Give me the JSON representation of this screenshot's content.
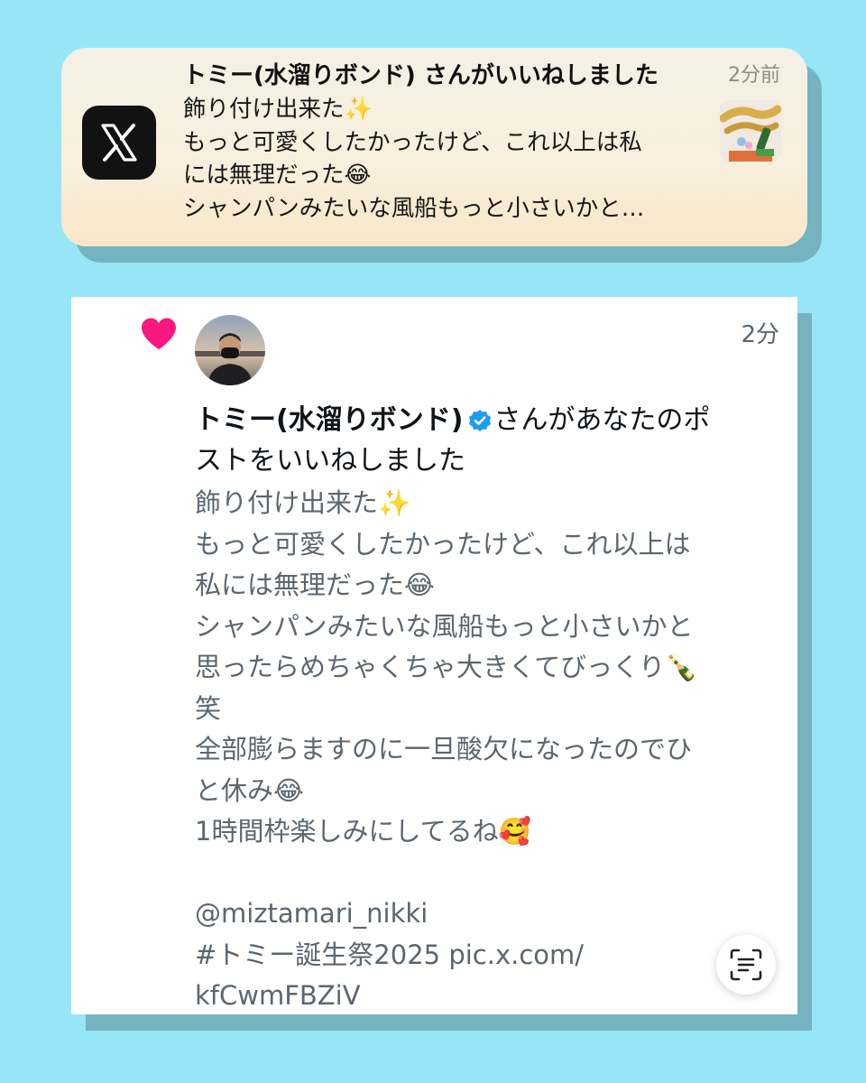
{
  "notification": {
    "app_icon": "x-logo-icon",
    "title": "トミー(水溜りボンド) さんがいいねしました",
    "time": "2分前",
    "lines": [
      "飾り付け出来た✨",
      "もっと可愛くしたかったけど、これ以上は私",
      "には無理だった😂",
      "シャンパンみたいな風船もっと小さいかと…"
    ],
    "thumbnail": "birthday-balloons-thumbnail"
  },
  "card": {
    "icon": "heart-icon",
    "time": "2分",
    "user_name": "トミー(水溜りボンド)",
    "verified_icon": "verified-badge-icon",
    "action_line1": "さんがあなたのポ",
    "action_line2": "ストをいいねしました",
    "body_lines": [
      "飾り付け出来た✨",
      "もっと可愛くしたかったけど、これ以上は",
      "私には無理だった😂",
      "シャンパンみたいな風船もっと小さいかと",
      "思ったらめちゃくちゃ大きくてびっくり🍾",
      "笑",
      "全部膨らますのに一旦酸欠になったのでひ",
      "と休み😂",
      "1時間枠楽しみにしてるね🥰",
      "",
      "@miztamari_nikki",
      " #トミー誕生祭2025 pic.x.com/",
      "kfCwmFBZiV"
    ],
    "live_text_icon": "live-text-icon"
  },
  "colors": {
    "background": "#97e6f8",
    "heart": "#f91880",
    "verified": "#1d9bf0",
    "body_text": "#5b6670"
  }
}
